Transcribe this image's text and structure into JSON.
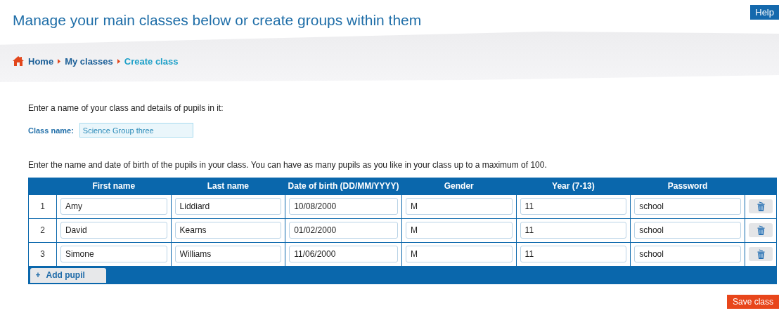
{
  "title": "Manage your main classes below or create groups within them",
  "help_button": "Help",
  "breadcrumb": [
    {
      "label": "Home",
      "selected": false
    },
    {
      "label": "My classes",
      "selected": false
    },
    {
      "label": "Create class",
      "selected": true
    }
  ],
  "intro": "Enter a name of your class and details of pupils in it:",
  "class_name": {
    "label": "Class name:",
    "value": "Science Group three"
  },
  "instructions": "Enter the name and date of birth of the pupils in your class. You can have as many pupils as you like in your class up to a maximum of 100.",
  "table": {
    "columns": [
      "First name",
      "Last name",
      "Date of birth (DD/MM/YYYY)",
      "Gender",
      "Year (7-13)",
      "Password"
    ],
    "rows": [
      {
        "number": "1",
        "values": [
          "Amy",
          "Liddiard",
          "10/08/2000",
          "M",
          "11",
          "school"
        ]
      },
      {
        "number": "2",
        "values": [
          "David",
          "Kearns",
          "01/02/2000",
          "M",
          "11",
          "school"
        ]
      },
      {
        "number": "3",
        "values": [
          "Simone",
          "Williams",
          "11/06/2000",
          "M",
          "11",
          "school"
        ]
      }
    ],
    "add_button": {
      "icon": "+",
      "label": "Add pupil"
    }
  },
  "save_button": "Save class"
}
